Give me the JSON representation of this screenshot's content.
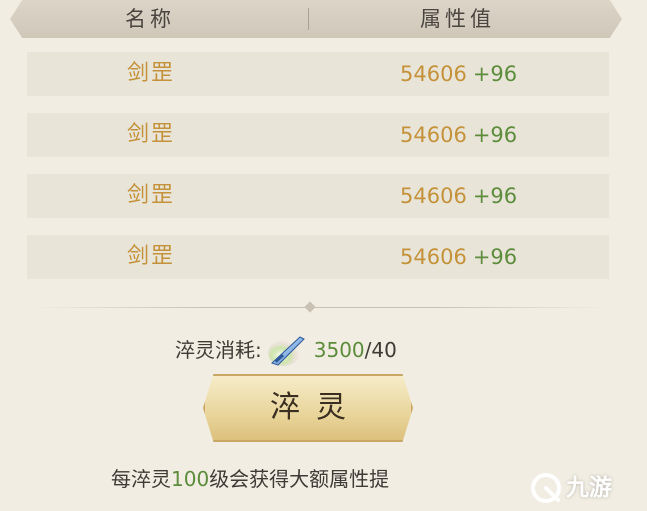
{
  "table": {
    "headers": {
      "name": "名称",
      "attr": "属性值"
    },
    "rows": [
      {
        "name": "剑罡",
        "base": "54606",
        "bonus": "+96"
      },
      {
        "name": "剑罡",
        "base": "54606",
        "bonus": "+96"
      },
      {
        "name": "剑罡",
        "base": "54606",
        "bonus": "+96"
      },
      {
        "name": "剑罡",
        "base": "54606",
        "bonus": "+96"
      }
    ]
  },
  "cost": {
    "label": "淬灵消耗:",
    "item_icon": "sword-icon",
    "have": "3500",
    "need": "/40"
  },
  "button": {
    "label": "淬灵"
  },
  "tip": {
    "prefix": "每淬灵",
    "number": "100",
    "suffix": "级会获得大额属性提"
  },
  "watermark": {
    "text": "九游",
    "icon": "jiuyou-logo-icon"
  },
  "colors": {
    "gold_text": "#c4923a",
    "green_text": "#5c8c3c",
    "background": "#f1ede2",
    "row_bg": "#e9e4d8"
  }
}
